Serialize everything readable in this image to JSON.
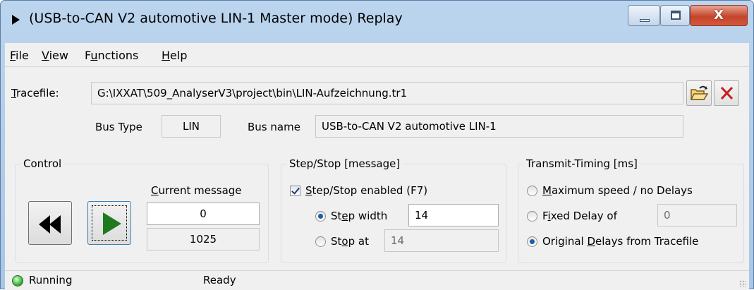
{
  "window": {
    "title": "(USB-to-CAN V2 automotive  LIN-1 Master mode) Replay",
    "close_glyph": "X"
  },
  "menu": {
    "items": [
      {
        "access_key": "F",
        "rest": "ile"
      },
      {
        "access_key": "V",
        "rest": "iew"
      },
      {
        "prefix": "F",
        "access_key": "u",
        "rest": "nctions"
      },
      {
        "access_key": "H",
        "rest": "elp"
      }
    ]
  },
  "tracefile": {
    "label_key": "T",
    "label_rest": "racefile:",
    "path": "G:\\IXXAT\\509_AnalyserV3\\project\\bin\\LIN-Aufzeichnung.tr1",
    "open_icon": "folder-open-icon",
    "clear_icon": "close-x-icon"
  },
  "bus": {
    "type_label": "Bus Type",
    "type_value": "LIN",
    "name_label": "Bus name",
    "name_value": "USB-to-CAN V2 automotive  LIN-1"
  },
  "control": {
    "group_title": "Control",
    "current_label_key": "C",
    "current_label_rest": "urrent message",
    "current_value": "0",
    "total_value": "1025"
  },
  "step_stop": {
    "group_title": "Step/Stop  [message]",
    "enabled_key": "S",
    "enabled_rest": "tep/Stop enabled  (F7)",
    "enabled_checked": true,
    "step_width_pre": "St",
    "step_width_key": "e",
    "step_width_post": "p width",
    "step_width_value": "14",
    "stop_at_pre": "St",
    "stop_at_key": "o",
    "stop_at_post": "p at",
    "stop_at_value": "14",
    "selected": "step_width"
  },
  "transmit": {
    "group_title": "Transmit-Timing  [ms]",
    "max_key": "M",
    "max_rest": "aximum speed / no Delays",
    "fixed_pre": "F",
    "fixed_key": "i",
    "fixed_post": "xed Delay of",
    "fixed_value": "0",
    "orig_pre": "Original ",
    "orig_key": "D",
    "orig_post": "elays from Tracefile",
    "selected": "original"
  },
  "status": {
    "state": "Running",
    "message": "Ready",
    "led_color": "#3cb53c"
  }
}
